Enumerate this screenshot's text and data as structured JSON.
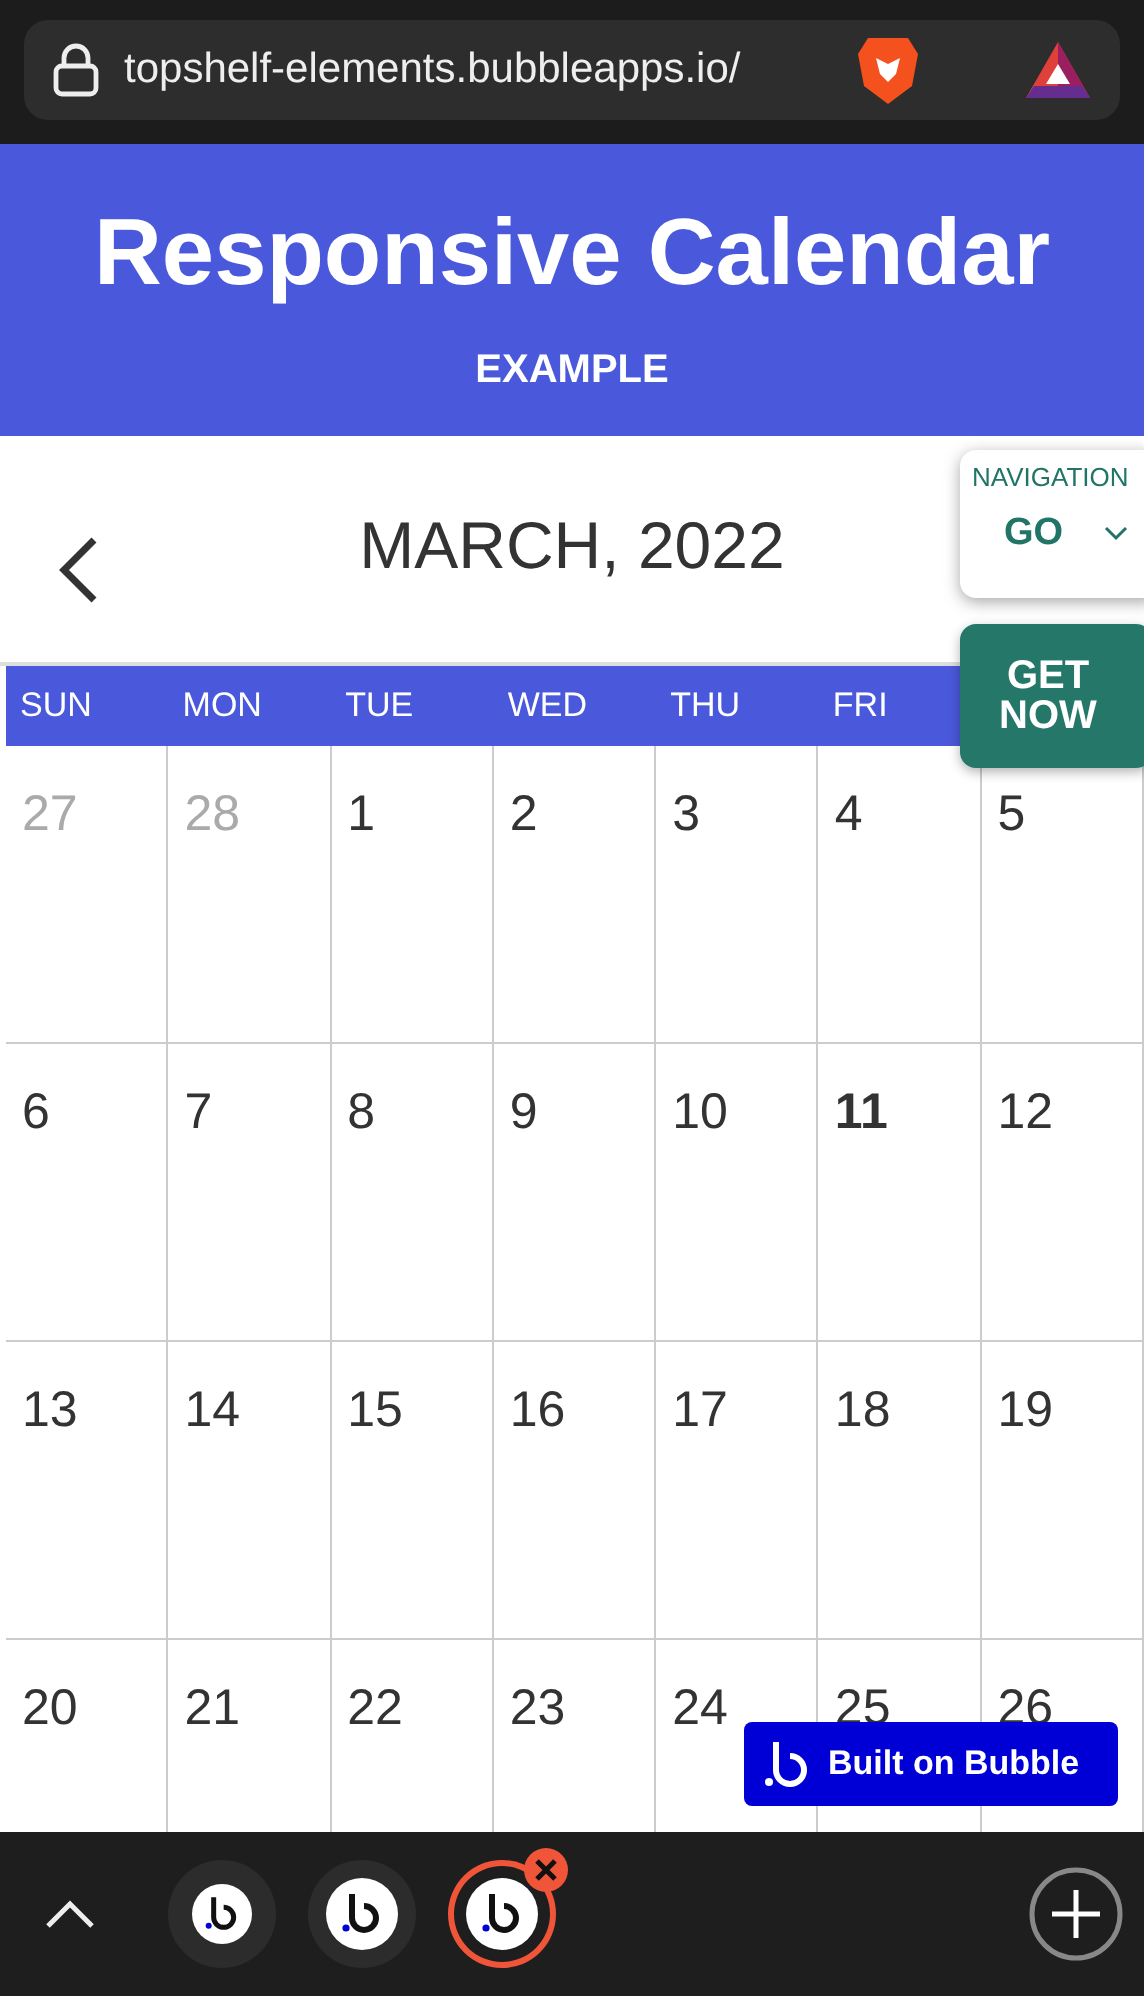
{
  "browser": {
    "url": "topshelf-elements.bubbleapps.io/"
  },
  "header": {
    "title": "Responsive Calendar",
    "subtitle": "EXAMPLE"
  },
  "calendar": {
    "month": "MARCH, 2022",
    "weekdays": [
      "SUN",
      "MON",
      "TUE",
      "WED",
      "THU",
      "FRI"
    ],
    "weeks": [
      [
        {
          "label": "27",
          "muted": true,
          "today": false
        },
        {
          "label": "28",
          "muted": true,
          "today": false
        },
        {
          "label": "1",
          "muted": false,
          "today": false
        },
        {
          "label": "2",
          "muted": false,
          "today": false
        },
        {
          "label": "3",
          "muted": false,
          "today": false
        },
        {
          "label": "4",
          "muted": false,
          "today": false
        },
        {
          "label": "5",
          "muted": false,
          "today": false
        }
      ],
      [
        {
          "label": "6",
          "muted": false,
          "today": false
        },
        {
          "label": "7",
          "muted": false,
          "today": false
        },
        {
          "label": "8",
          "muted": false,
          "today": false
        },
        {
          "label": "9",
          "muted": false,
          "today": false
        },
        {
          "label": "10",
          "muted": false,
          "today": false
        },
        {
          "label": "11",
          "muted": false,
          "today": true
        },
        {
          "label": "12",
          "muted": false,
          "today": false
        }
      ],
      [
        {
          "label": "13",
          "muted": false,
          "today": false
        },
        {
          "label": "14",
          "muted": false,
          "today": false
        },
        {
          "label": "15",
          "muted": false,
          "today": false
        },
        {
          "label": "16",
          "muted": false,
          "today": false
        },
        {
          "label": "17",
          "muted": false,
          "today": false
        },
        {
          "label": "18",
          "muted": false,
          "today": false
        },
        {
          "label": "19",
          "muted": false,
          "today": false
        }
      ],
      [
        {
          "label": "20",
          "muted": false,
          "today": false
        },
        {
          "label": "21",
          "muted": false,
          "today": false
        },
        {
          "label": "22",
          "muted": false,
          "today": false
        },
        {
          "label": "23",
          "muted": false,
          "today": false
        },
        {
          "label": "24",
          "muted": false,
          "today": false
        },
        {
          "label": "25",
          "muted": false,
          "today": false
        },
        {
          "label": "26",
          "muted": false,
          "today": false
        }
      ]
    ]
  },
  "navigation": {
    "label": "NAVIGATION",
    "value": "GO"
  },
  "cta": {
    "label": "GET NOW"
  },
  "badge": {
    "label": "Built on Bubble"
  },
  "tabs": [
    {
      "selected": false
    },
    {
      "selected": false
    },
    {
      "selected": true
    }
  ]
}
